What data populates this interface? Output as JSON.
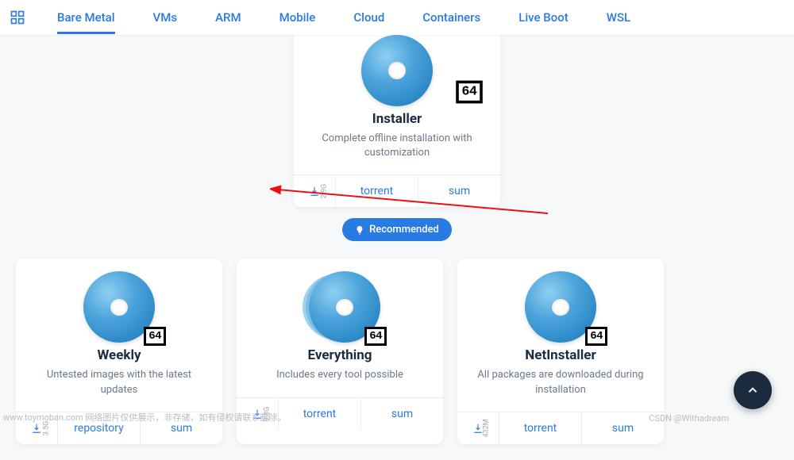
{
  "nav": {
    "items": [
      "Bare Metal",
      "VMs",
      "ARM",
      "Mobile",
      "Cloud",
      "Containers",
      "Live Boot",
      "WSL"
    ],
    "active_index": 0
  },
  "recommended_label": "Recommended",
  "arch_badge": "64",
  "top_card": {
    "title": "Installer",
    "desc": "Complete offline installation with customization",
    "size": "2.9G",
    "actions": {
      "torrent": "torrent",
      "sum": "sum"
    }
  },
  "cards": [
    {
      "title": "Weekly",
      "desc": "Untested images with the latest updates",
      "size": "3.5G",
      "actions": {
        "mid": "repository",
        "sum": "sum"
      }
    },
    {
      "title": "Everything",
      "desc": "Includes every tool possible",
      "size": "9.8G",
      "actions": {
        "mid": "torrent",
        "sum": "sum"
      }
    },
    {
      "title": "NetInstaller",
      "desc": "All packages are downloaded during installation",
      "size": "432M",
      "actions": {
        "mid": "torrent",
        "sum": "sum"
      }
    }
  ],
  "watermarks": {
    "left": "www.toymoban.com 网络图片仅供展示，非存储，如有侵权请联系删除。",
    "right": "CSDN @Withadream"
  }
}
